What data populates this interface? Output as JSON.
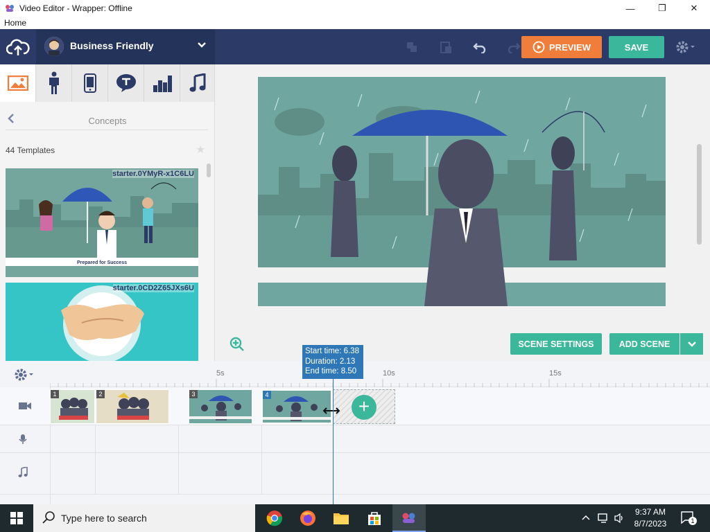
{
  "window": {
    "title": "Video Editor - Wrapper: Offline",
    "menu": "Home",
    "controls": {
      "minimize": "—",
      "maximize": "❐",
      "close": "✕"
    }
  },
  "header": {
    "theme_name": "Business Friendly",
    "preview_label": "PREVIEW",
    "save_label": "SAVE",
    "colors": {
      "header_bg": "#2b3a66",
      "preview": "#f07d39",
      "save": "#3bb89c"
    }
  },
  "library": {
    "tabs": [
      "image-icon",
      "character-icon",
      "phone-icon",
      "speech-bubble-icon",
      "chart-icon",
      "music-icon"
    ],
    "section_title": "Concepts",
    "template_count": "44 Templates",
    "templates": [
      {
        "id": "starter.0YMyR-x1C6LU",
        "caption": "Prepared for Success"
      },
      {
        "id": "starter.0CD2Z65JXs6U"
      }
    ]
  },
  "stage": {
    "scene_settings_label": "SCENE SETTINGS",
    "add_scene_label": "ADD SCENE"
  },
  "timeline": {
    "ruler_labels": [
      "5s",
      "10s",
      "15s"
    ],
    "scenes": [
      "1",
      "2",
      "3",
      "4"
    ],
    "tooltip": {
      "start": "Start time: 6.38",
      "duration": "Duration: 2.13",
      "end": "End time: 8.50"
    }
  },
  "taskbar": {
    "search_placeholder": "Type here to search",
    "time": "9:37 AM",
    "date": "8/7/2023",
    "notification_count": "1"
  }
}
